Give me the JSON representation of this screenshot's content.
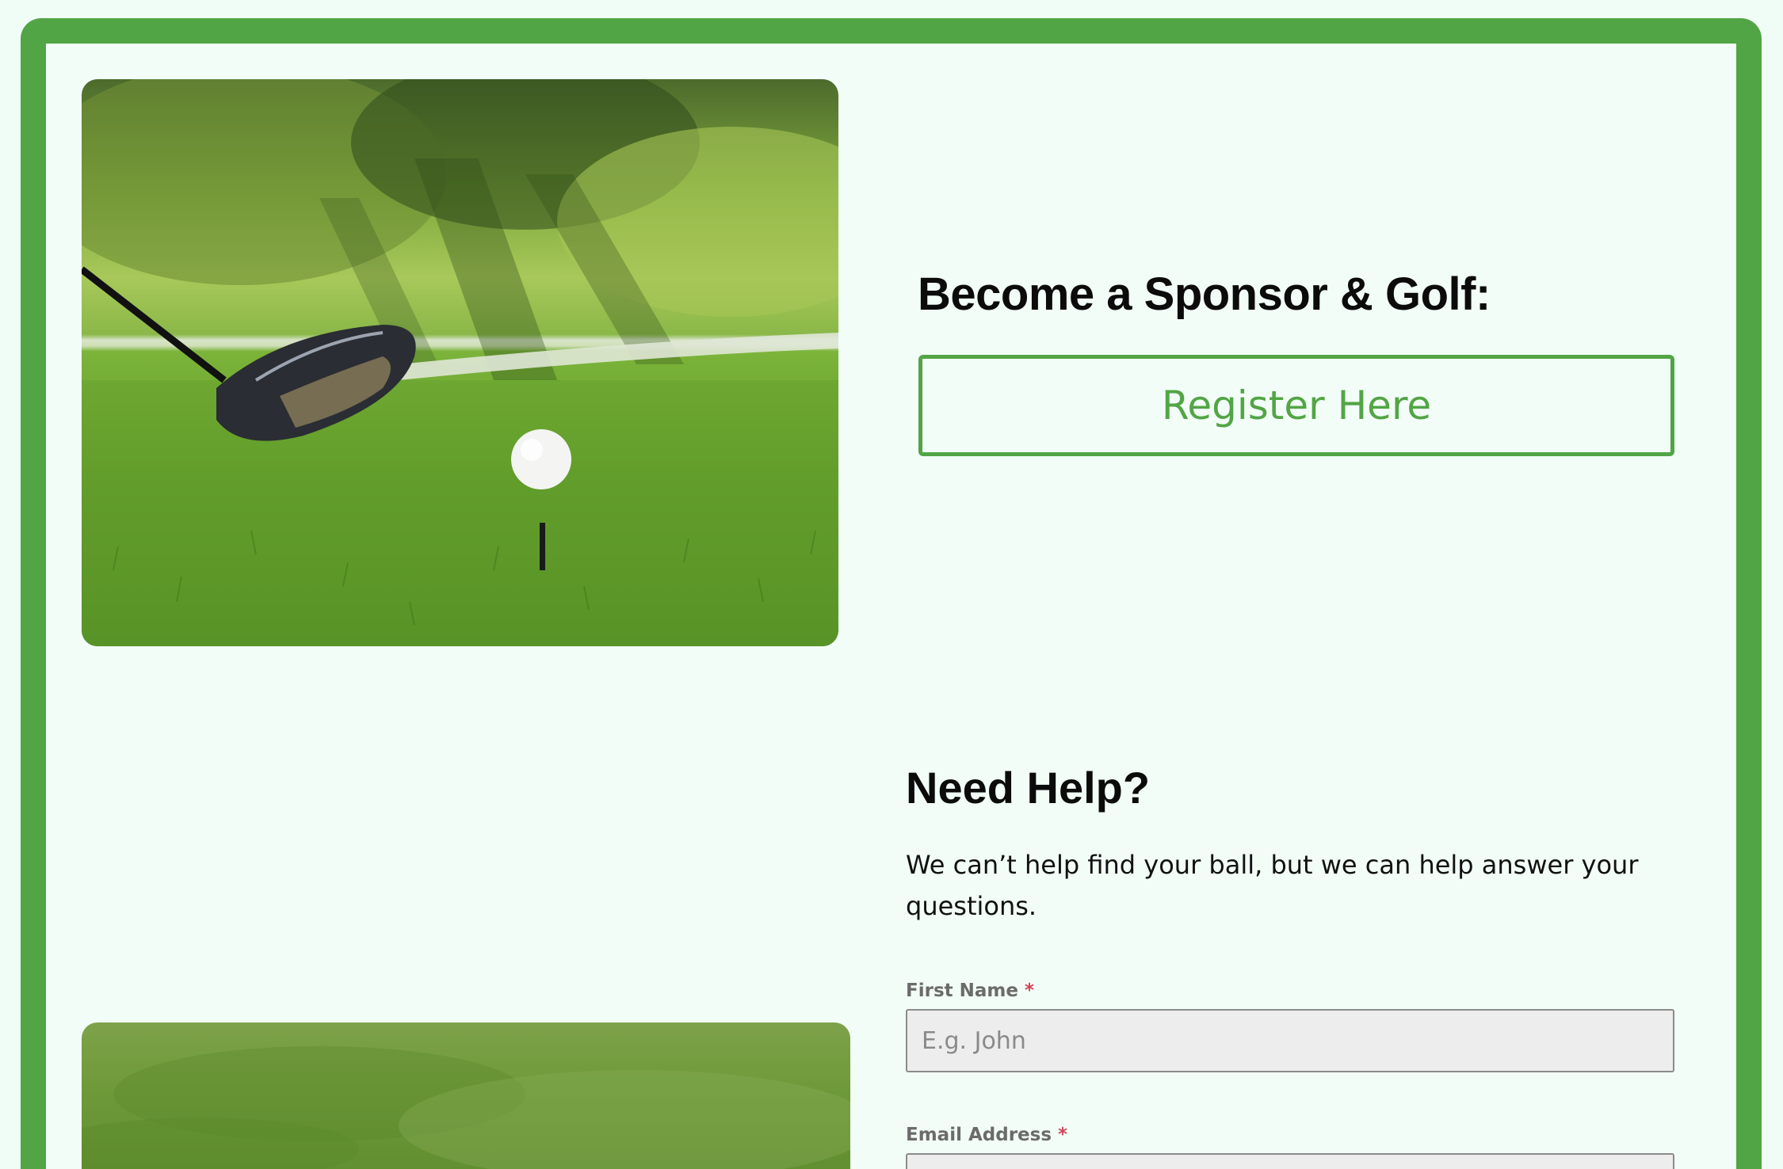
{
  "sponsor": {
    "heading": "Become a Sponsor & Golf:",
    "register_label": "Register Here"
  },
  "help": {
    "heading": "Need Help?",
    "text": "We can’t help find your ball, but we can help answer your questions."
  },
  "form": {
    "first_name": {
      "label": "First Name",
      "required_mark": "*",
      "placeholder": "E.g. John"
    },
    "email": {
      "label": "Email Address",
      "required_mark": "*",
      "placeholder": ""
    }
  },
  "colors": {
    "accent": "#52a545",
    "background": "#f2fdf7",
    "required": "#d0465a"
  }
}
